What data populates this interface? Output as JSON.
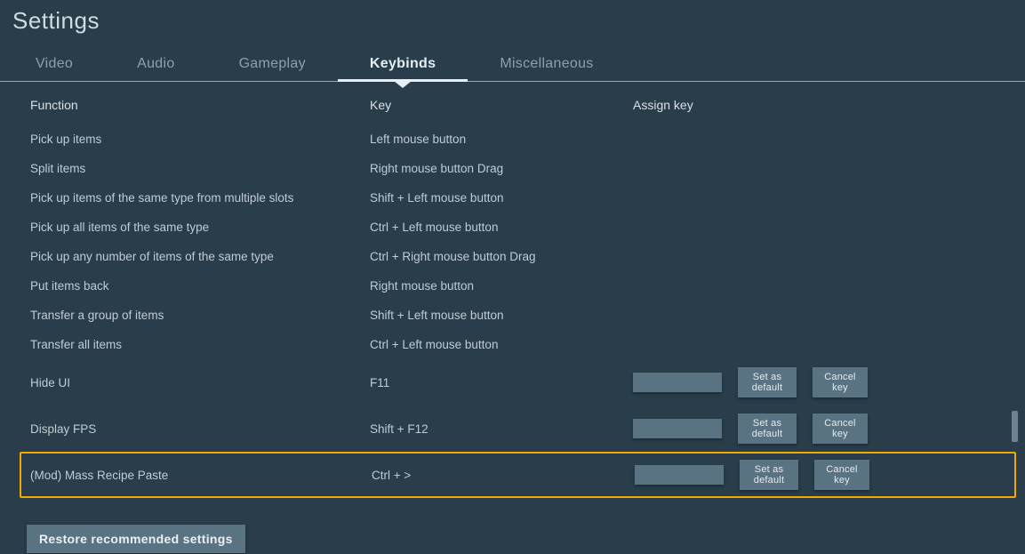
{
  "title": "Settings",
  "tabs": [
    {
      "label": "Video",
      "active": false
    },
    {
      "label": "Audio",
      "active": false
    },
    {
      "label": "Gameplay",
      "active": false
    },
    {
      "label": "Keybinds",
      "active": true
    },
    {
      "label": "Miscellaneous",
      "active": false
    }
  ],
  "columns": {
    "function": "Function",
    "key": "Key",
    "assign": "Assign key"
  },
  "buttons": {
    "set_default": "Set as default",
    "cancel_key": "Cancel key",
    "restore": "Restore recommended settings"
  },
  "rows": [
    {
      "function": "Pick up items",
      "key": "Left mouse button",
      "assignable": false,
      "highlight": false
    },
    {
      "function": "Split items",
      "key": "Right mouse button Drag",
      "assignable": false,
      "highlight": false
    },
    {
      "function": "Pick up items of the same type from multiple slots",
      "key": "Shift + Left mouse button",
      "assignable": false,
      "highlight": false
    },
    {
      "function": "Pick up all items of the same type",
      "key": "Ctrl + Left mouse button",
      "assignable": false,
      "highlight": false
    },
    {
      "function": "Pick up any number of items of the same type",
      "key": "Ctrl + Right mouse button Drag",
      "assignable": false,
      "highlight": false
    },
    {
      "function": "Put items back",
      "key": "Right mouse button",
      "assignable": false,
      "highlight": false
    },
    {
      "function": "Transfer a group of items",
      "key": "Shift + Left mouse button",
      "assignable": false,
      "highlight": false
    },
    {
      "function": "Transfer all items",
      "key": "Ctrl + Left mouse button",
      "assignable": false,
      "highlight": false
    },
    {
      "function": "Hide UI",
      "key": "F11",
      "assignable": true,
      "highlight": false
    },
    {
      "function": "Display FPS",
      "key": "Shift + F12",
      "assignable": true,
      "highlight": false
    },
    {
      "function": "(Mod) Mass Recipe Paste",
      "key": "Ctrl + >",
      "assignable": true,
      "highlight": true
    }
  ]
}
